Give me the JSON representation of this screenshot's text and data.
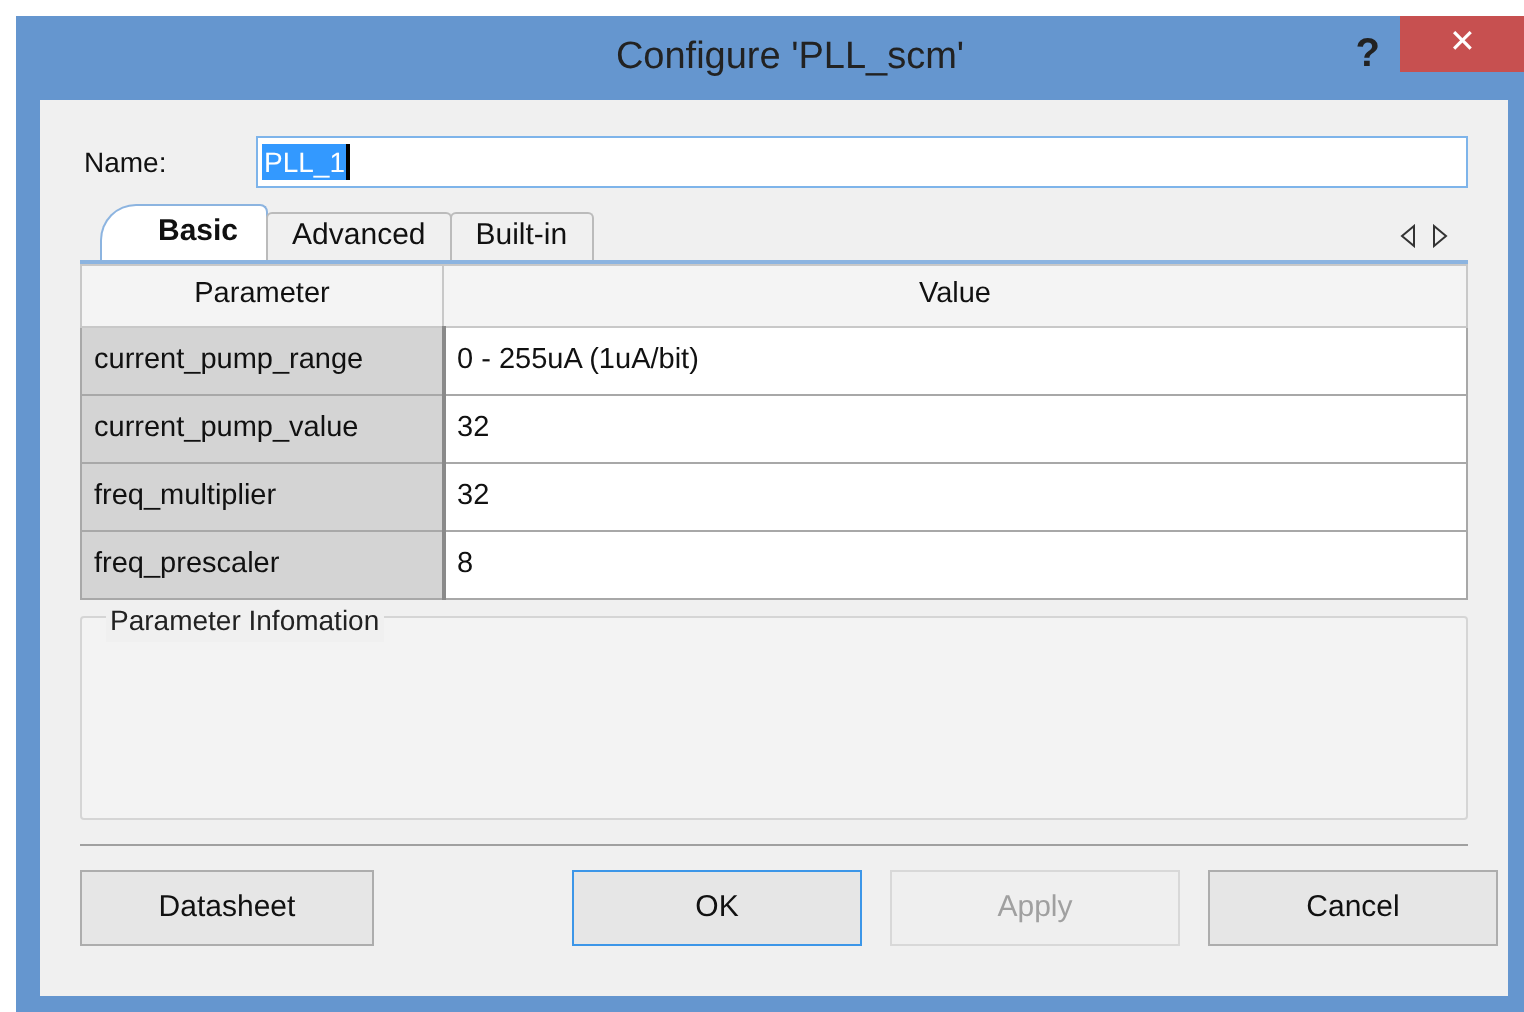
{
  "window": {
    "title": "Configure 'PLL_scm'",
    "help": "?",
    "close": "✕"
  },
  "name_field": {
    "label": "Name:",
    "value": "PLL_1",
    "selected": true
  },
  "tabs": [
    {
      "label": "Basic",
      "selected": true
    },
    {
      "label": "Advanced",
      "selected": false
    },
    {
      "label": "Built-in",
      "selected": false
    }
  ],
  "table": {
    "columns": [
      "Parameter",
      "Value"
    ],
    "rows": [
      {
        "parameter": "current_pump_range",
        "value": "0 - 255uA (1uA/bit)"
      },
      {
        "parameter": "current_pump_value",
        "value": "32"
      },
      {
        "parameter": "freq_multiplier",
        "value": "32"
      },
      {
        "parameter": "freq_prescaler",
        "value": "8"
      }
    ]
  },
  "info_group": {
    "title": "Parameter Infomation"
  },
  "buttons": [
    {
      "label": "Datasheet",
      "disabled": false,
      "default": false
    },
    {
      "label": "OK",
      "disabled": false,
      "default": true
    },
    {
      "label": "Apply",
      "disabled": true,
      "default": false
    },
    {
      "label": "Cancel",
      "disabled": false,
      "default": false
    }
  ]
}
